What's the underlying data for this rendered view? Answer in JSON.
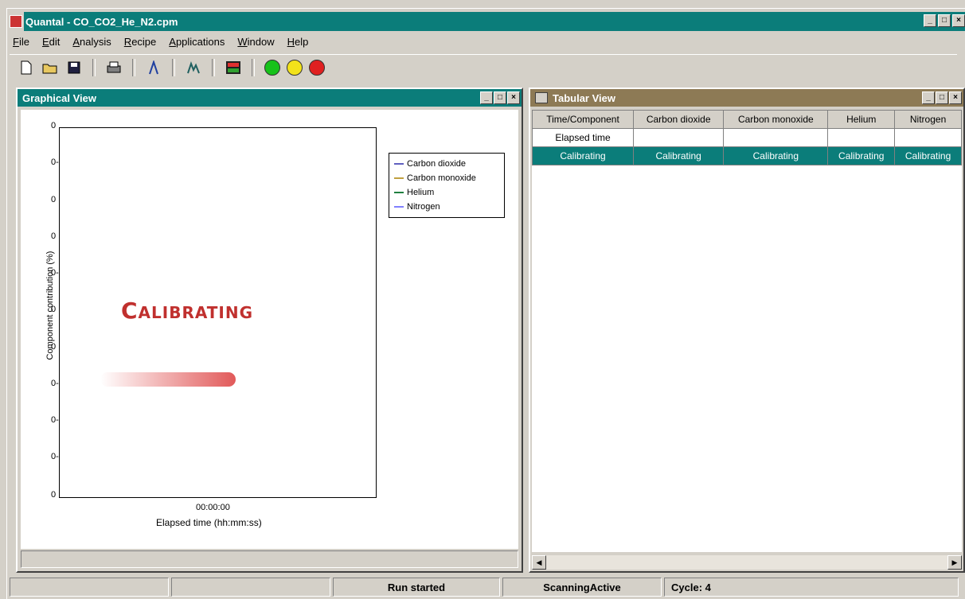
{
  "app": {
    "title": "Quantal - CO_CO2_He_N2.cpm"
  },
  "menu": [
    "File",
    "Edit",
    "Analysis",
    "Recipe",
    "Applications",
    "Window",
    "Help"
  ],
  "toolbar": {
    "icons": [
      "new-icon",
      "open-icon",
      "save-icon",
      "print-icon",
      "tune-icon",
      "peak-icon",
      "recipe-icon"
    ],
    "leds": [
      {
        "name": "start-light",
        "color": "#17c21a"
      },
      {
        "name": "pause-light",
        "color": "#f2e21a"
      },
      {
        "name": "stop-light",
        "color": "#e02020"
      }
    ]
  },
  "graph": {
    "title": "Graphical View",
    "yticks": [
      "0",
      "0-",
      "0",
      "0",
      "0-",
      "0",
      "0",
      "0-",
      "0-",
      "0-",
      "0"
    ],
    "ylabel": "Component contribution (%)",
    "xtick": "00:00:00",
    "xlabel": "Elapsed time (hh:mm:ss)",
    "overlay_text": "Calibrating",
    "legend": [
      {
        "label": "Carbon dioxide",
        "color": "#6060c0"
      },
      {
        "label": "Carbon monoxide",
        "color": "#c0a040"
      },
      {
        "label": "Helium",
        "color": "#208040"
      },
      {
        "label": "Nitrogen",
        "color": "#8080ff"
      }
    ]
  },
  "table": {
    "title": "Tabular View",
    "headers": [
      "Time/Component",
      "Carbon dioxide",
      "Carbon monoxide",
      "Helium",
      "Nitrogen"
    ],
    "rows": [
      [
        "Elapsed time",
        "",
        "",
        "",
        ""
      ],
      [
        "Calibrating",
        "Calibrating",
        "Calibrating",
        "Calibrating",
        "Calibrating"
      ]
    ]
  },
  "status": {
    "cells": [
      "",
      "",
      "Run started",
      "ScanningActive",
      "Cycle: 4"
    ]
  }
}
